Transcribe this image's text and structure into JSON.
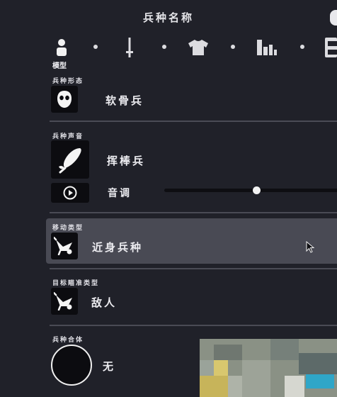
{
  "header": {
    "title": "兵种名称"
  },
  "tabs": [
    {
      "icon": "person-icon",
      "label": "模型",
      "active": true
    },
    {
      "icon": "sword-icon"
    },
    {
      "icon": "shirt-icon"
    },
    {
      "icon": "stats-icon"
    },
    {
      "icon": "save-icon"
    }
  ],
  "sections": {
    "shape": {
      "label": "兵种形态",
      "value": "软骨兵",
      "icon": "mask-icon"
    },
    "sound": {
      "label": "兵种声音",
      "value": "挥棒兵",
      "icon": "feather-icon",
      "pitch_label": "音调",
      "pitch_icon": "play-icon",
      "pitch_level": 0.52
    },
    "movement": {
      "label": "移动类型",
      "value": "近身兵种",
      "icon": "wheelbarrow-icon"
    },
    "target": {
      "label": "目标瞄准类型",
      "value": "敌人",
      "icon": "wheelbarrow-icon"
    },
    "combo": {
      "label": "兵种合体",
      "value": "无"
    }
  },
  "colors": {
    "background": "#202129",
    "selected_row": "#494a54",
    "icon_bg": "#0c0c10"
  }
}
